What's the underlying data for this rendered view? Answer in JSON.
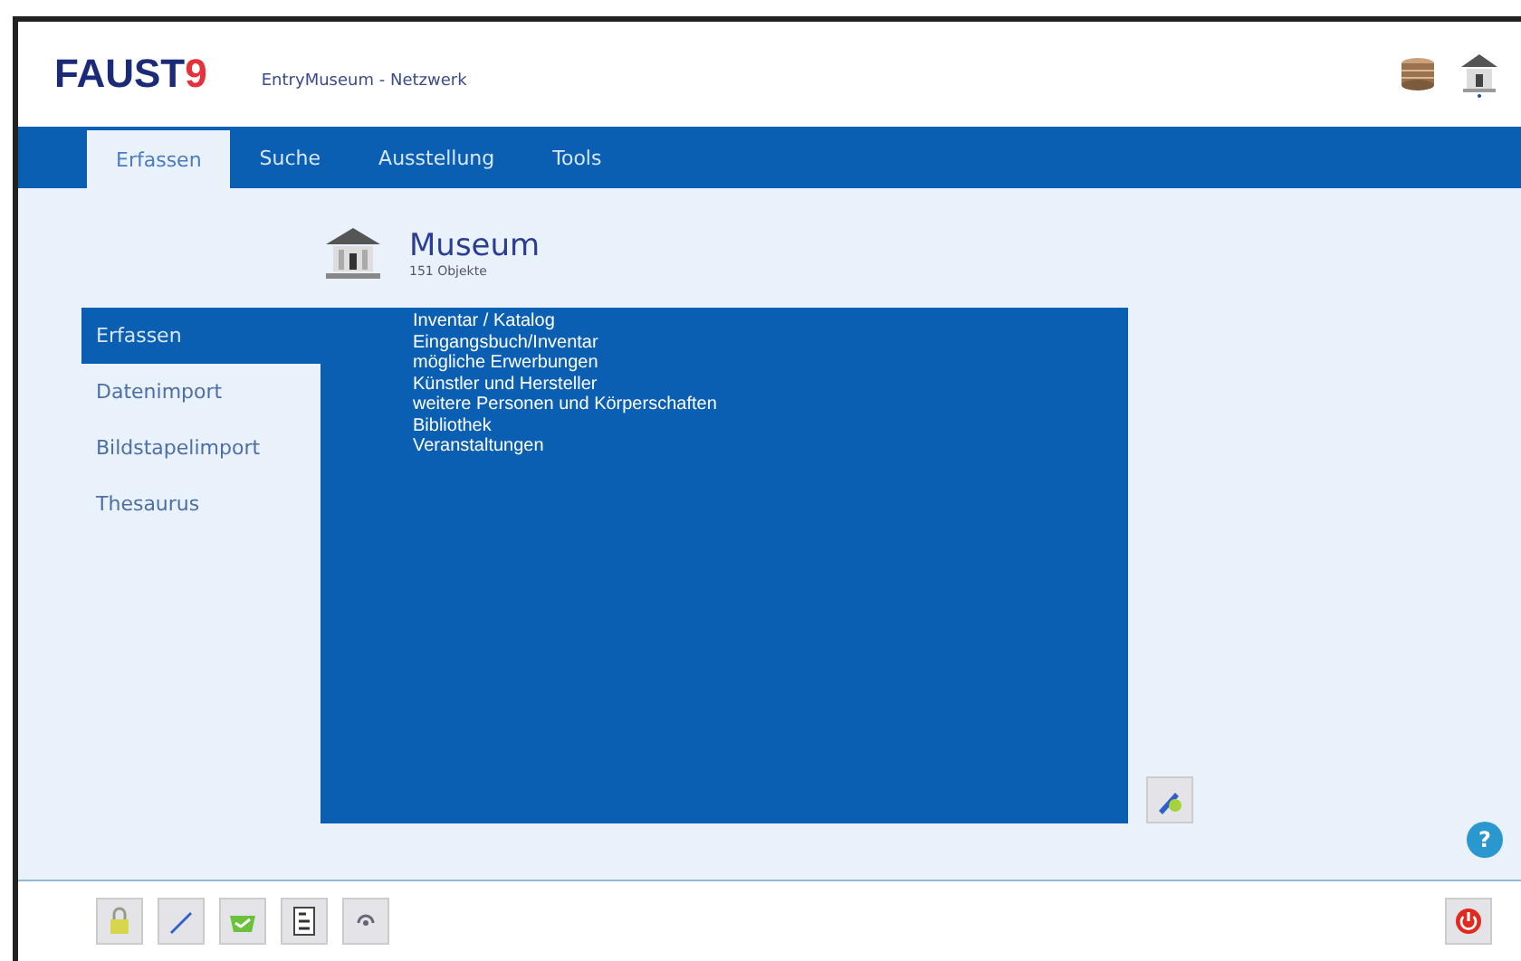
{
  "header": {
    "logo": {
      "name": "FAUST",
      "version": "9"
    },
    "subtitle": "EntryMuseum - Netzwerk"
  },
  "tabs": [
    {
      "label": "Erfassen",
      "selected": true
    },
    {
      "label": "Suche",
      "selected": false
    },
    {
      "label": "Ausstellung",
      "selected": false
    },
    {
      "label": "Tools",
      "selected": false
    }
  ],
  "database": {
    "title": "Museum",
    "count": "151 Objekte"
  },
  "sidebar": {
    "items": [
      {
        "label": "Erfassen",
        "selected": true
      },
      {
        "label": "Datenimport",
        "selected": false
      },
      {
        "label": "Bildstapelimport",
        "selected": false
      },
      {
        "label": "Thesaurus",
        "selected": false
      }
    ]
  },
  "menu": {
    "items": [
      "Inventar / Katalog",
      "Eingangsbuch/Inventar",
      "mögliche Erwerbungen",
      "Künstler und Hersteller",
      "weitere Personen und Körperschaften",
      "Bibliothek",
      "Veranstaltungen"
    ]
  },
  "help": {
    "label": "?"
  }
}
